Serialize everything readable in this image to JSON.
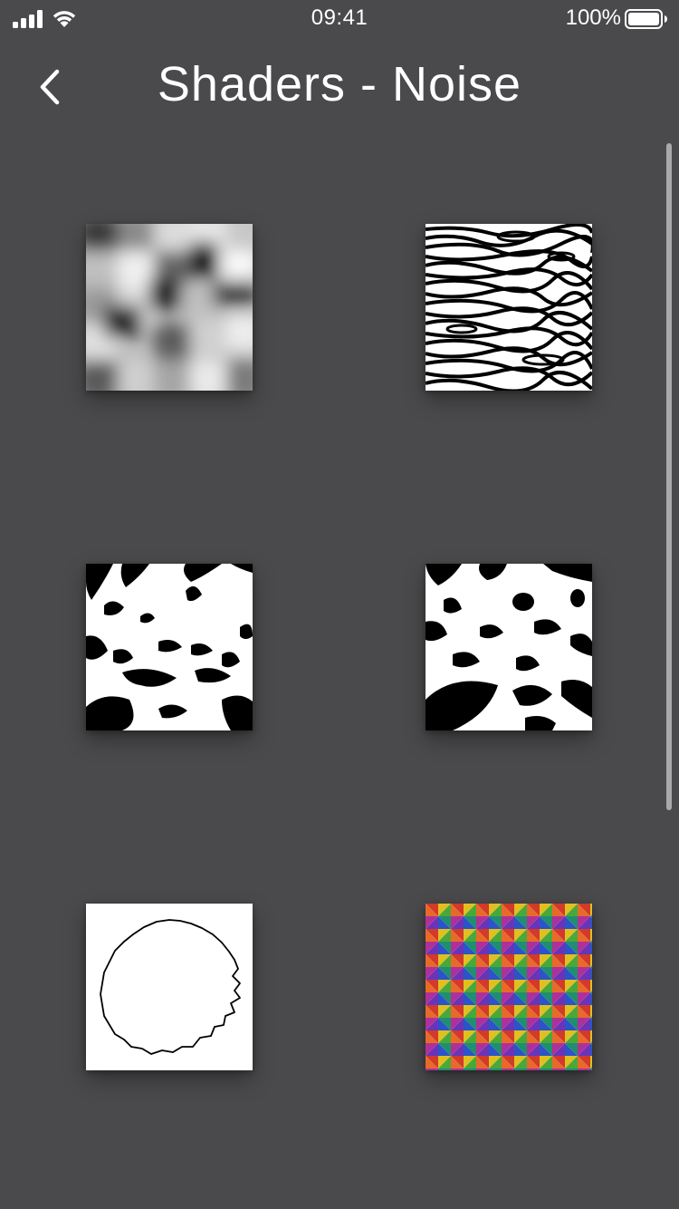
{
  "status_bar": {
    "time": "09:41",
    "battery_percent": "100%",
    "signal_icon": "cellular-signal-icon",
    "wifi_icon": "wifi-icon",
    "battery_icon": "battery-full-icon"
  },
  "nav": {
    "back_icon": "chevron-left-icon",
    "title": "Shaders - Noise"
  },
  "tiles": [
    {
      "id": "value-noise",
      "icon": "blurred-value-noise-preview"
    },
    {
      "id": "stripe-noise",
      "icon": "zebra-stripe-noise-preview"
    },
    {
      "id": "marble-noise-a",
      "icon": "black-white-marble-noise-preview"
    },
    {
      "id": "marble-noise-b",
      "icon": "black-white-marble-noise-preview"
    },
    {
      "id": "wobbly-circle",
      "icon": "noisy-circle-outline-preview"
    },
    {
      "id": "rainbow-tiles",
      "icon": "rainbow-triangle-grid-preview"
    }
  ],
  "colors": {
    "background": "#4a4a4c",
    "foreground": "#ffffff",
    "scrollbar": "#a9a9ab"
  }
}
